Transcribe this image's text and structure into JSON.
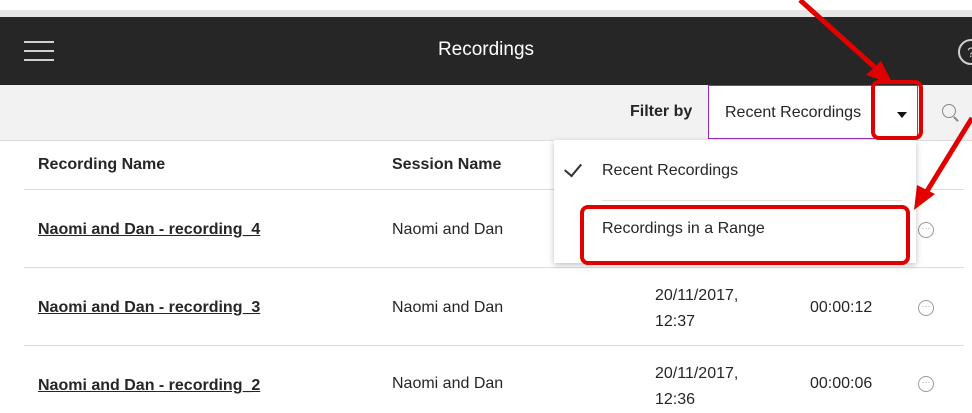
{
  "header": {
    "title": "Recordings"
  },
  "filter": {
    "label": "Filter by",
    "selected": "Recent Recordings"
  },
  "table": {
    "columns": [
      "Recording Name",
      "Session Name"
    ],
    "rows": [
      {
        "name": "Naomi and Dan - recording_4",
        "session": "Naomi and Dan",
        "date": "",
        "time": "",
        "duration": ""
      },
      {
        "name": "Naomi and Dan - recording_3",
        "session": "Naomi and Dan",
        "date": "20/11/2017,",
        "time": "12:37",
        "duration": "00:00:12"
      },
      {
        "name": "Naomi and Dan - recording_2",
        "session": "Naomi and Dan",
        "date": "20/11/2017,",
        "time": "12:36",
        "duration": "00:00:06"
      }
    ]
  },
  "menu": {
    "items": [
      "Recent Recordings",
      "Recordings in a Range"
    ],
    "checked": "Recent Recordings"
  },
  "annotations": {
    "color": "#e00000"
  }
}
